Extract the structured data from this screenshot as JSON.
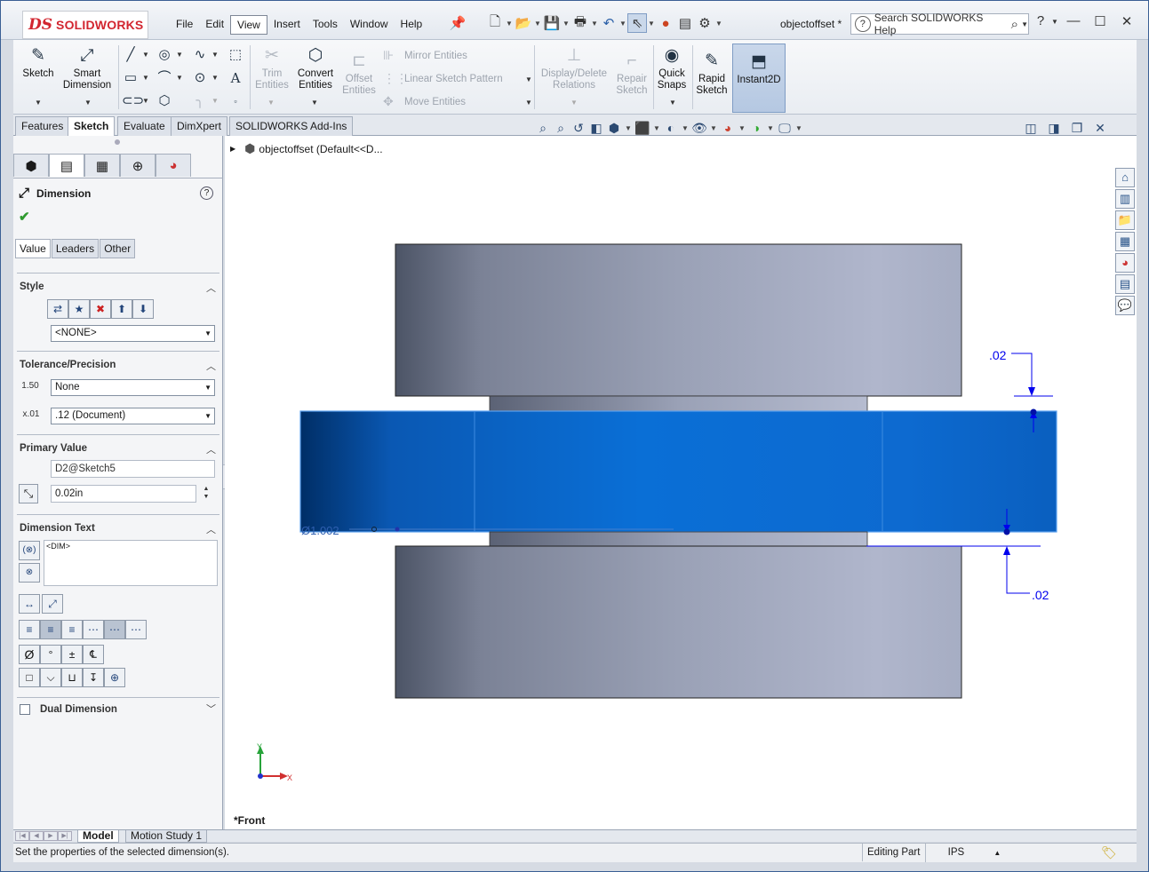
{
  "app": {
    "brand_ds": "DS",
    "brand_name": "SOLIDWORKS",
    "doc_title": "objectoffset *"
  },
  "menu": [
    "File",
    "Edit",
    "View",
    "Insert",
    "Tools",
    "Window",
    "Help"
  ],
  "menu_active": "View",
  "search": {
    "label": "Search SOLIDWORKS Help"
  },
  "ribbon": {
    "sketch": "Sketch",
    "smart_dimension": [
      "Smart",
      "Dimension"
    ],
    "trim": [
      "Trim",
      "Entities"
    ],
    "convert": [
      "Convert",
      "Entities"
    ],
    "offset": [
      "Offset",
      "Entities"
    ],
    "mirror": "Mirror Entities",
    "linear_pattern": "Linear Sketch Pattern",
    "move": "Move Entities",
    "display_delete": [
      "Display/Delete",
      "Relations"
    ],
    "repair": [
      "Repair",
      "Sketch"
    ],
    "quick_snaps": [
      "Quick",
      "Snaps"
    ],
    "rapid_sketch": [
      "Rapid",
      "Sketch"
    ],
    "instant2d": "Instant2D"
  },
  "cm_tabs": [
    "Features",
    "Sketch",
    "Evaluate",
    "DimXpert",
    "SOLIDWORKS Add-Ins"
  ],
  "cm_tab_active": "Sketch",
  "property_manager": {
    "title": "Dimension",
    "tabs": [
      "Value",
      "Leaders",
      "Other"
    ],
    "active_tab": "Value",
    "style": {
      "heading": "Style",
      "selected": "<NONE>"
    },
    "tolerance": {
      "heading": "Tolerance/Precision",
      "tolerance_type": "None",
      "precision": ".12 (Document)",
      "tol_icon": "1.50",
      "prec_icon": "x.01"
    },
    "primary_value": {
      "heading": "Primary Value",
      "name": "D2@Sketch5",
      "value": "0.02in"
    },
    "dimension_text": {
      "heading": "Dimension Text",
      "text": "<DIM>"
    },
    "dual_dimension": "Dual Dimension"
  },
  "tree": {
    "item": "objectoffset  (Default<<D..."
  },
  "viewport": {
    "view_name": "*Front",
    "dim_top": ".02",
    "dim_bottom": ".02",
    "dia_label": "Ø1.002",
    "axis_x": "X",
    "axis_y": "Y",
    "colors": {
      "selected_face": "#0a6fd6",
      "dimension": "#0000ee",
      "body": "#a9b2c7"
    }
  },
  "bottom_tabs": [
    "Model",
    "Motion Study 1"
  ],
  "bottom_tab_active": "Model",
  "status": {
    "message": "Set the properties of the selected dimension(s).",
    "mode": "Editing Part",
    "units": "IPS"
  }
}
